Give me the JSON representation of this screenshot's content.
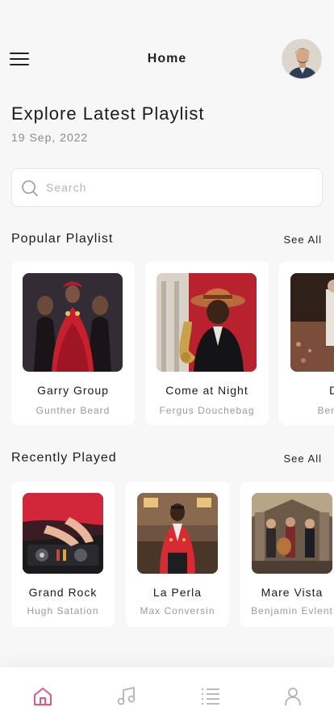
{
  "header": {
    "title": "Home"
  },
  "explore": {
    "title": "Explore Latest Playlist",
    "date": "19 Sep, 2022"
  },
  "search": {
    "placeholder": "Search",
    "value": ""
  },
  "popular": {
    "title": "Popular Playlist",
    "see_all": "See All",
    "items": [
      {
        "name": "Garry Group",
        "artist": "Gunther Beard"
      },
      {
        "name": "Come at Night",
        "artist": "Fergus Douchebag"
      },
      {
        "name": "Dan",
        "artist": "Benjamin"
      }
    ]
  },
  "recent": {
    "title": "Recently Played",
    "see_all": "See All",
    "items": [
      {
        "name": "Grand Rock",
        "artist": "Hugh Satation"
      },
      {
        "name": "La Perla",
        "artist": "Max Conversin"
      },
      {
        "name": "Mare Vista",
        "artist": "Benjamin Evlent"
      }
    ]
  },
  "nav": {
    "items": [
      {
        "icon": "home-icon",
        "active": true
      },
      {
        "icon": "music-note-icon",
        "active": false
      },
      {
        "icon": "list-icon",
        "active": false
      },
      {
        "icon": "profile-icon",
        "active": false
      }
    ]
  },
  "colors": {
    "accent": "#e05a7a",
    "inactive_icon": "#b3b3b3",
    "background": "#f7f7f7",
    "card": "#ffffff"
  }
}
